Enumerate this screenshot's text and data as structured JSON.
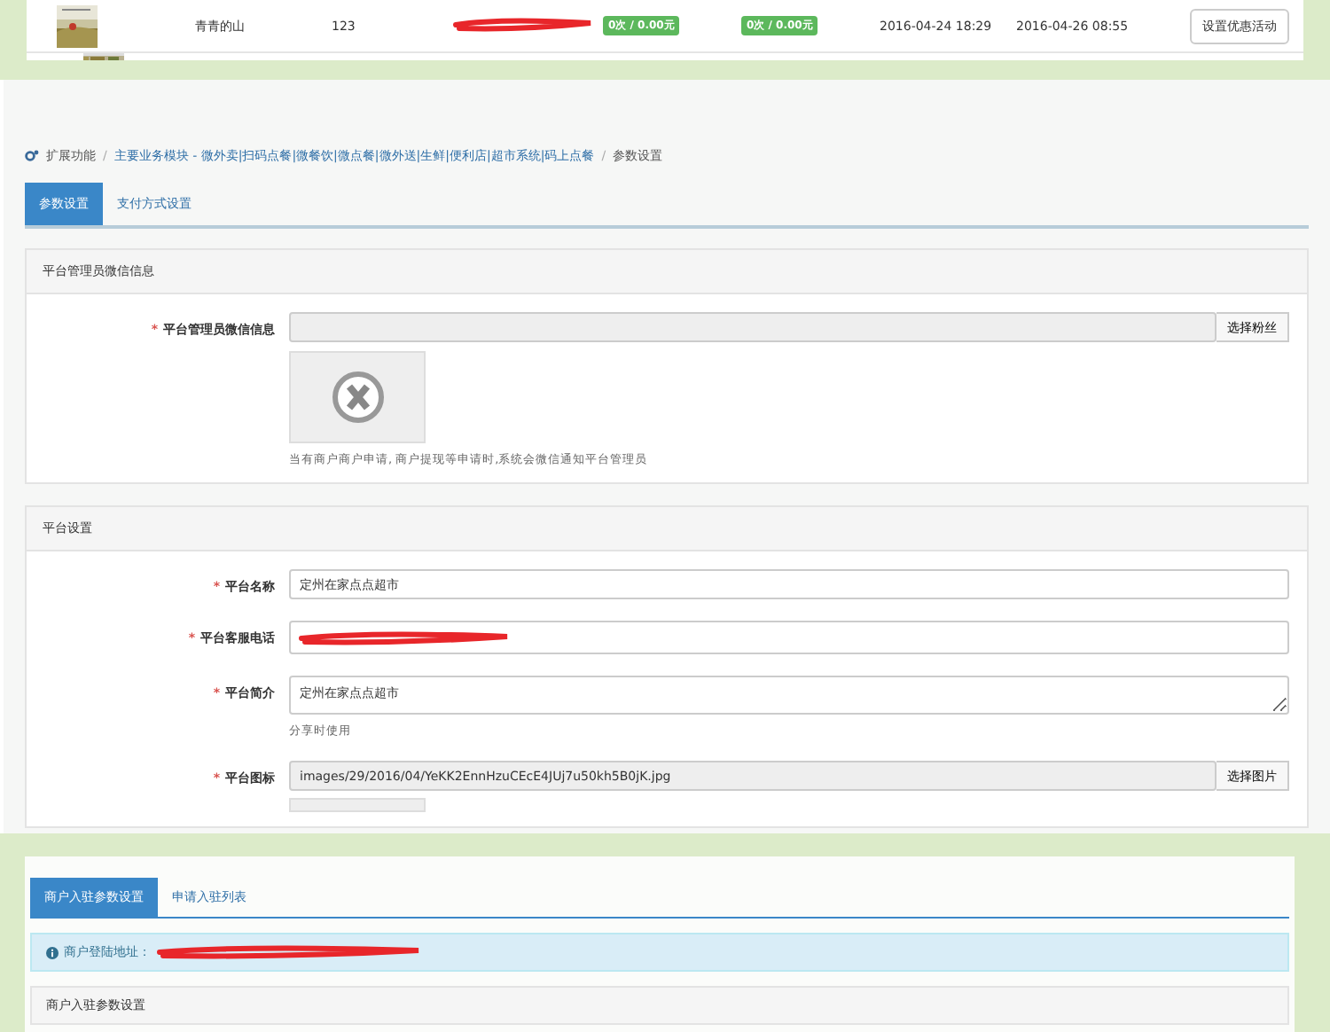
{
  "list_row": {
    "name": "青青的山",
    "count": "123",
    "badges": [
      "0次 / 0.00元",
      "0次 / 0.00元"
    ],
    "created": "2016-04-24 18:29",
    "updated": "2016-04-26 08:55",
    "action": "设置优惠活动"
  },
  "settings_page": {
    "breadcrumb": [
      {
        "kind": "root",
        "text": "扩展功能"
      },
      {
        "kind": "separator",
        "text": "/"
      },
      {
        "kind": "link",
        "text": "主要业务模块 - 微外卖|扫码点餐|微餐饮|微点餐|微外送|生鲜|便利店|超市系统|码上点餐"
      },
      {
        "kind": "separator",
        "text": "/"
      },
      {
        "kind": "current",
        "text": "参数设置"
      }
    ],
    "tabs": [
      {
        "label": "参数设置",
        "selected": true
      },
      {
        "label": "支付方式设置",
        "selected": false
      }
    ],
    "sections": [
      {
        "title": "平台管理员微信信息",
        "rows": [
          {
            "kind": "fan_picker",
            "mark": "*",
            "label": "平台管理员微信信息",
            "value": "",
            "button": "选择粉丝",
            "help": "当有商户商户申请, 商户提现等申请时,系统会微信通知平台管理员"
          }
        ]
      },
      {
        "title": "平台设置",
        "rows": [
          {
            "kind": "text",
            "mark": "*",
            "label": "平台名称",
            "value": "定州在家点点超市"
          },
          {
            "kind": "redacted",
            "mark": "*",
            "label": "平台客服电话"
          },
          {
            "kind": "textarea",
            "mark": "*",
            "label": "平台简介",
            "value": "定州在家点点超市",
            "help": "分享时使用"
          },
          {
            "kind": "image_picker",
            "mark": "*",
            "label": "平台图标",
            "value": "images/29/2016/04/YeKK2EnnHzuCEcE4JUj7u50kh5B0jK.jpg",
            "button": "选择图片"
          }
        ]
      }
    ]
  },
  "merchant_page": {
    "tabs": [
      {
        "label": "商户入驻参数设置",
        "selected": true
      },
      {
        "label": "申请入驻列表",
        "selected": false
      }
    ],
    "alert": "商户登陆地址：",
    "section_title": "商户入驻参数设置"
  }
}
